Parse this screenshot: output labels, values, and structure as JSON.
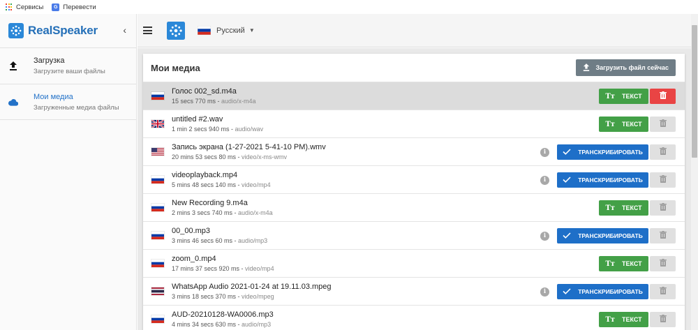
{
  "bookmarks": {
    "services": "Сервисы",
    "translate": "Перевести",
    "apps_colors": [
      "#ea4335",
      "#fbbc05",
      "#34a853",
      "#4285f4",
      "#ea4335",
      "#fbbc05",
      "#34a853",
      "#4285f4",
      "#ea4335"
    ]
  },
  "sidebar": {
    "brand": "RealSpeaker",
    "items": [
      {
        "title": "Загрузка",
        "subtitle": "Загрузите ваши файлы",
        "icon": "upload-icon"
      },
      {
        "title": "Мои медиа",
        "subtitle": "Загруженные медиа файлы",
        "icon": "cloud-icon",
        "active": true
      }
    ]
  },
  "topbar": {
    "language": "Русский"
  },
  "main": {
    "title": "Мои медиа",
    "upload_label": "Загрузить файл сейчас",
    "text_label": "ТЕКСТ",
    "transcribe_label": "ТРАНСКРИБИРОВАТЬ",
    "files": [
      {
        "name": "Голос 002_sd.m4a",
        "duration": "15 secs 770 ms",
        "mime": "audio/x-m4a",
        "flag": "ru",
        "action": "text",
        "selected": true
      },
      {
        "name": "untitled #2.wav",
        "duration": "1 min 2 secs 940 ms",
        "mime": "audio/wav",
        "flag": "uk",
        "action": "text"
      },
      {
        "name": "Запись экрана (1-27-2021 5-41-10 PM).wmv",
        "duration": "20 mins 53 secs 80 ms",
        "mime": "video/x-ms-wmv",
        "flag": "us",
        "action": "transcribe"
      },
      {
        "name": "videoplayback.mp4",
        "duration": "5 mins 48 secs 140 ms",
        "mime": "video/mp4",
        "flag": "ru",
        "action": "transcribe"
      },
      {
        "name": "New Recording 9.m4a",
        "duration": "2 mins 3 secs 740 ms",
        "mime": "audio/x-m4a",
        "flag": "ru",
        "action": "text"
      },
      {
        "name": "00_00.mp3",
        "duration": "3 mins 46 secs 60 ms",
        "mime": "audio/mp3",
        "flag": "ru",
        "action": "transcribe"
      },
      {
        "name": "zoom_0.mp4",
        "duration": "17 mins 37 secs 920 ms",
        "mime": "video/mp4",
        "flag": "ru",
        "action": "text"
      },
      {
        "name": "WhatsApp Audio 2021-01-24 at 19.11.03.mpeg",
        "duration": "3 mins 18 secs 370 ms",
        "mime": "video/mpeg",
        "flag": "th",
        "action": "transcribe"
      },
      {
        "name": "AUD-20210128-WA0006.mp3",
        "duration": "4 mins 34 secs 630 ms",
        "mime": "audio/mp3",
        "flag": "ru",
        "action": "text"
      }
    ]
  },
  "colors": {
    "accent": "#2372c8",
    "text_button": "#43a047",
    "transcribe_button": "#1e6fc8",
    "delete_active": "#e94444"
  }
}
